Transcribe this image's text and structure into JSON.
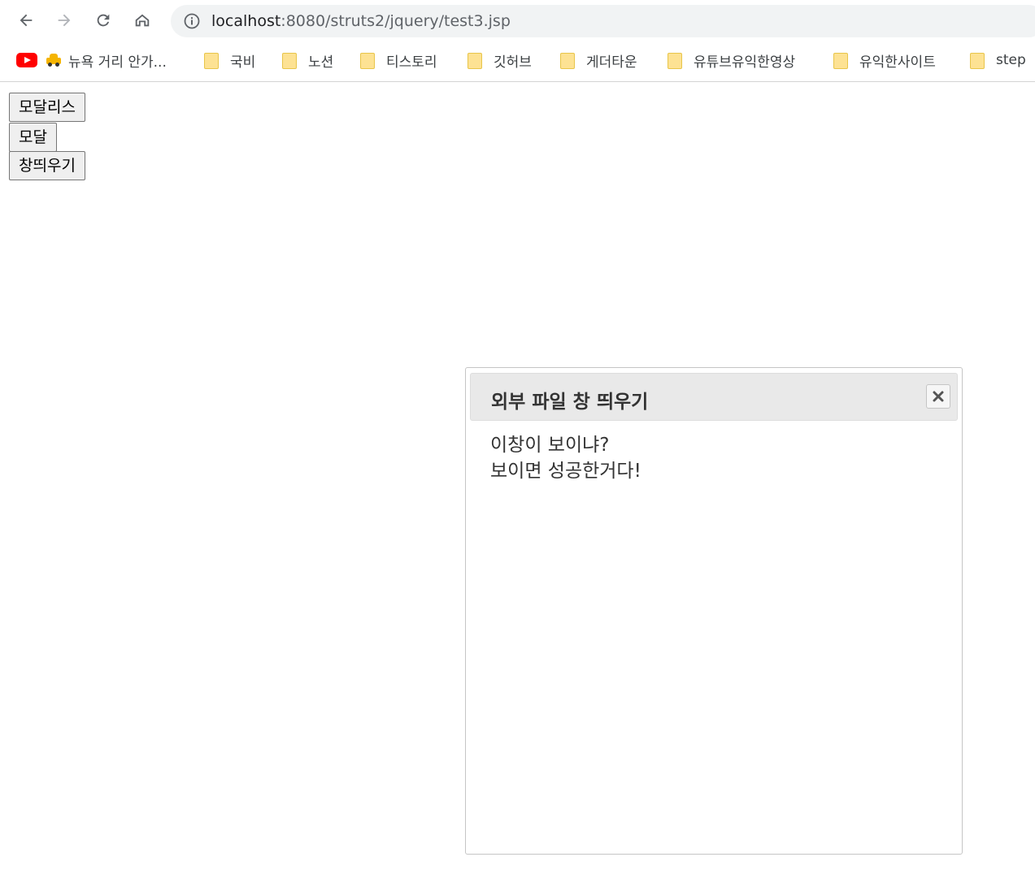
{
  "browser": {
    "url_host": "localhost",
    "url_path": ":8080/struts2/jquery/test3.jsp",
    "bookmarks": [
      {
        "label": "뉴욕 거리 안가...",
        "icon": "youtube-taxi"
      },
      {
        "label": "국비",
        "icon": "folder-icon"
      },
      {
        "label": "노션",
        "icon": "folder-icon"
      },
      {
        "label": "티스토리",
        "icon": "folder-icon"
      },
      {
        "label": "깃허브",
        "icon": "folder-icon"
      },
      {
        "label": "게더타운",
        "icon": "folder-icon"
      },
      {
        "label": "유튜브유익한영상",
        "icon": "folder-icon"
      },
      {
        "label": "유익한사이트",
        "icon": "folder-icon"
      },
      {
        "label": "step",
        "icon": "folder-icon"
      }
    ]
  },
  "page": {
    "buttons": {
      "modeless": "모달리스",
      "modal": "모달",
      "open_window": "창띄우기"
    }
  },
  "dialog": {
    "title": "외부 파일 창 띄우기",
    "content_line1": "이창이 보이냐?",
    "content_line2": "보이면 성공한거다!"
  },
  "colors": {
    "titlebar_bg": "#e9e9e9",
    "folder_fill": "#fde293",
    "youtube_red": "#ff0000"
  }
}
